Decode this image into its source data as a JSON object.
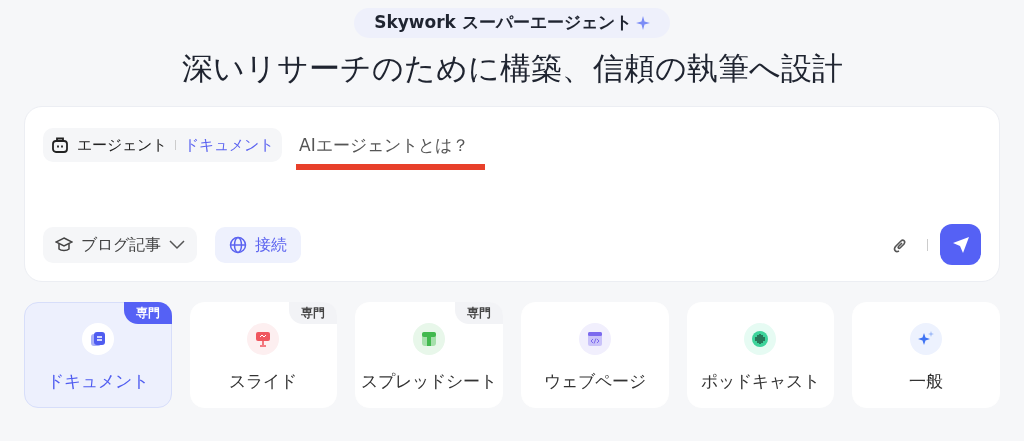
{
  "header": {
    "badge": "Skywork スーパーエージェント",
    "title": "深いリサーチのために構築、信頼の執筆へ設計"
  },
  "composer": {
    "mode": {
      "label": "エージェント",
      "sub": "ドキュメント"
    },
    "input": {
      "placeholder": "AIエージェントとは？",
      "underlined": true
    },
    "format_button": "ブログ記事",
    "connect_button": "接続"
  },
  "cards": [
    {
      "kind": "document",
      "label": "ドキュメント",
      "badge": "専門",
      "selected": true
    },
    {
      "kind": "slides",
      "label": "スライド",
      "badge": "専門",
      "selected": false
    },
    {
      "kind": "sheet",
      "label": "スプレッドシート",
      "badge": "専門",
      "selected": false
    },
    {
      "kind": "web",
      "label": "ウェブページ",
      "selected": false
    },
    {
      "kind": "podcast",
      "label": "ポッドキャスト",
      "selected": false
    },
    {
      "kind": "general",
      "label": "一般",
      "selected": false
    }
  ]
}
